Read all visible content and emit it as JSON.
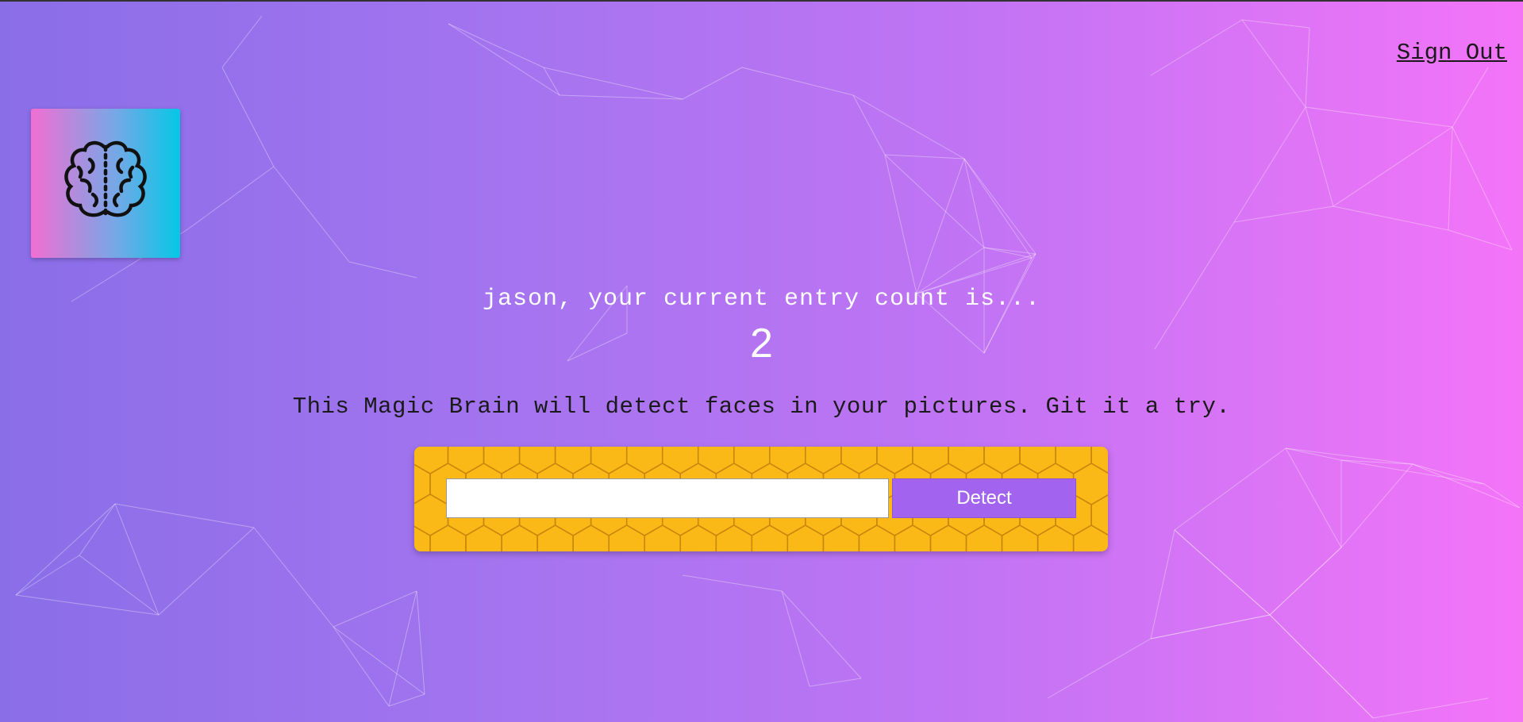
{
  "header": {
    "signout_label": "Sign Out"
  },
  "logo": {
    "icon": "brain-icon",
    "gradient": [
      "#f26ed2",
      "#04c8e6"
    ]
  },
  "rank": {
    "message": "jason, your current entry count is...",
    "count": "2"
  },
  "tagline": "This Magic Brain will detect faces in your pictures. Git it a try.",
  "form": {
    "input_value": "",
    "input_placeholder": "",
    "button_label": "Detect"
  },
  "colors": {
    "accent": "#a264ef",
    "form_bg": "#fbb917",
    "hex_stroke": "#c8860e"
  }
}
